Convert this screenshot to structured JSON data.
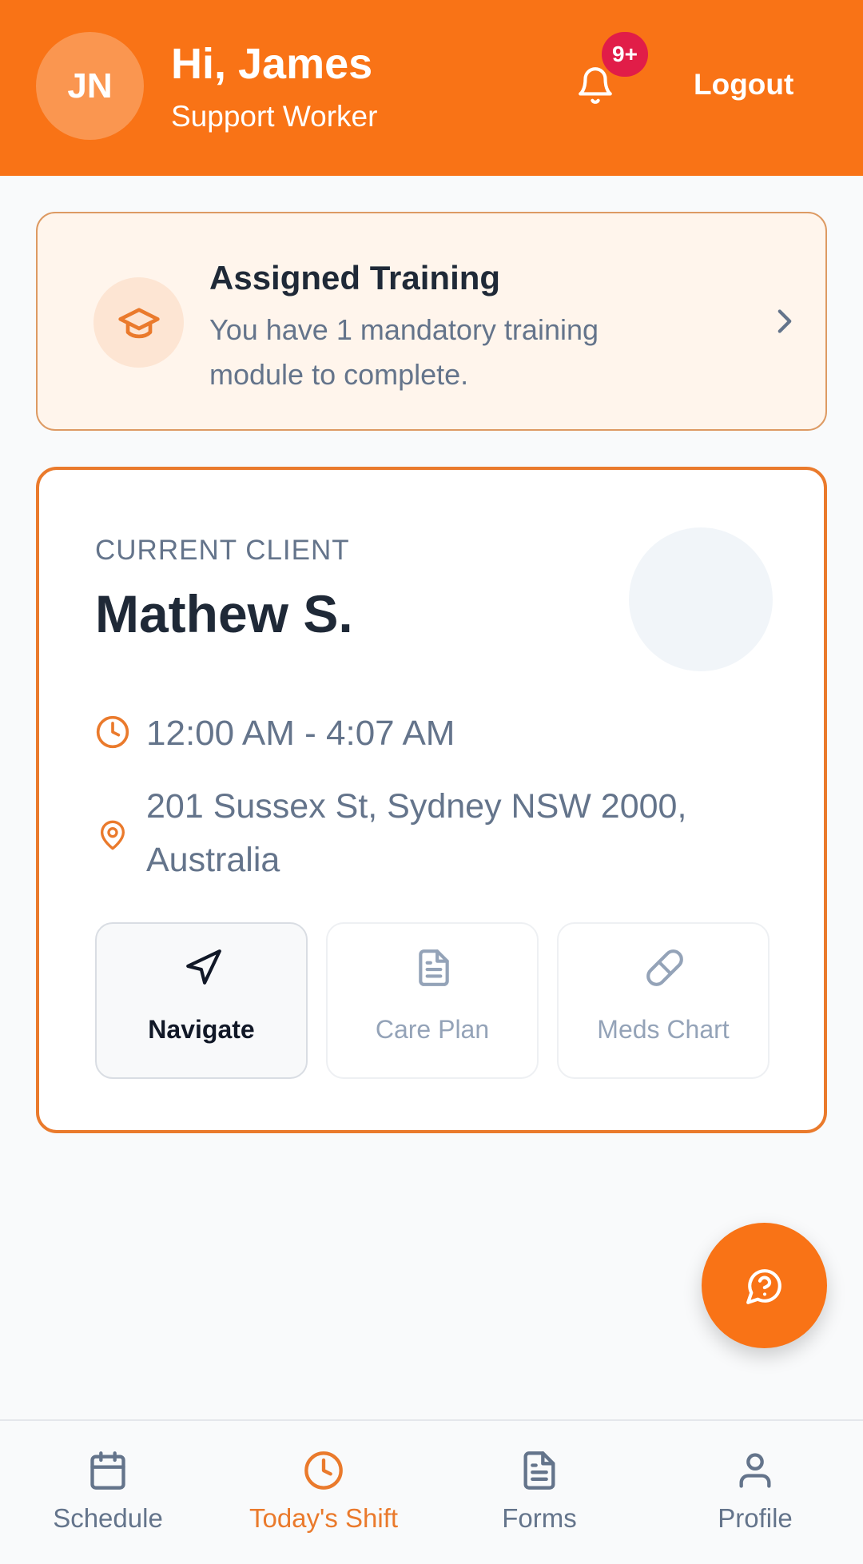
{
  "header": {
    "avatar_initials": "JN",
    "greeting": "Hi, James",
    "role": "Support Worker",
    "notification_badge": "9+",
    "logout_label": "Logout",
    "accent_color": "#f97316"
  },
  "training": {
    "title": "Assigned Training",
    "description": "You have 1 mandatory training module to complete.",
    "icon": "graduation-cap-icon"
  },
  "client": {
    "label": "CURRENT CLIENT",
    "name": "Mathew S.",
    "time": "12:00 AM - 4:07 AM",
    "address": "201 Sussex St, Sydney NSW 2000, Australia",
    "actions": [
      {
        "label": "Navigate",
        "icon": "navigation-arrow-icon"
      },
      {
        "label": "Care Plan",
        "icon": "document-icon"
      },
      {
        "label": "Meds Chart",
        "icon": "pill-icon"
      }
    ]
  },
  "fab": {
    "icon": "help-chat-icon"
  },
  "bottom_nav": {
    "items": [
      {
        "label": "Schedule",
        "icon": "calendar-icon"
      },
      {
        "label": "Today's Shift",
        "icon": "clock-icon",
        "active": true
      },
      {
        "label": "Forms",
        "icon": "form-document-icon"
      },
      {
        "label": "Profile",
        "icon": "user-icon"
      }
    ]
  }
}
